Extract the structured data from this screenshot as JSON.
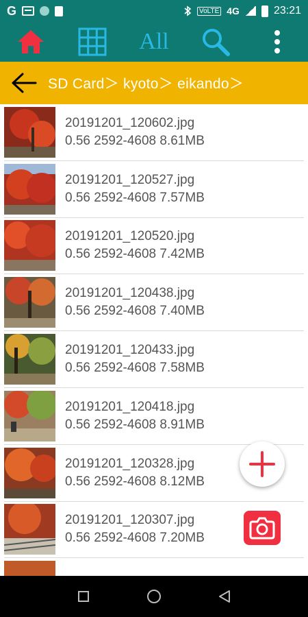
{
  "status_bar": {
    "left_icons": [
      "google-icon",
      "gmail-icon",
      "circle-dot-icon",
      "sd-card-icon"
    ],
    "g_label": "G",
    "volte": "VoLTE",
    "network": "4G",
    "time": "23:21"
  },
  "toolbar": {
    "all_label": "All",
    "icons": [
      "home-icon",
      "grid-icon",
      "search-icon",
      "more-vert-icon"
    ]
  },
  "breadcrumb": {
    "path": "SD Card＞ kyoto＞ eikando＞"
  },
  "files": [
    {
      "name": "20191201_120602.jpg",
      "info": "0.56 2592-4608  8.61MB"
    },
    {
      "name": "20191201_120527.jpg",
      "info": "0.56 2592-4608  7.57MB"
    },
    {
      "name": "20191201_120520.jpg",
      "info": "0.56 2592-4608  7.42MB"
    },
    {
      "name": "20191201_120438.jpg",
      "info": "0.56 2592-4608  7.40MB"
    },
    {
      "name": "20191201_120433.jpg",
      "info": "0.56 2592-4608  7.58MB"
    },
    {
      "name": "20191201_120418.jpg",
      "info": "0.56 2592-4608  8.91MB"
    },
    {
      "name": "20191201_120328.jpg",
      "info": "0.56 2592-4608  8.12MB"
    },
    {
      "name": "20191201_120307.jpg",
      "info": "0.56 2592-4608  7.20MB"
    },
    {
      "name": "",
      "info": ""
    }
  ],
  "colors": {
    "toolbar": "#0f7a72",
    "accent_red": "#f03040",
    "icon_blue": "#29b8e4",
    "breadcrumb": "#f0b400"
  }
}
